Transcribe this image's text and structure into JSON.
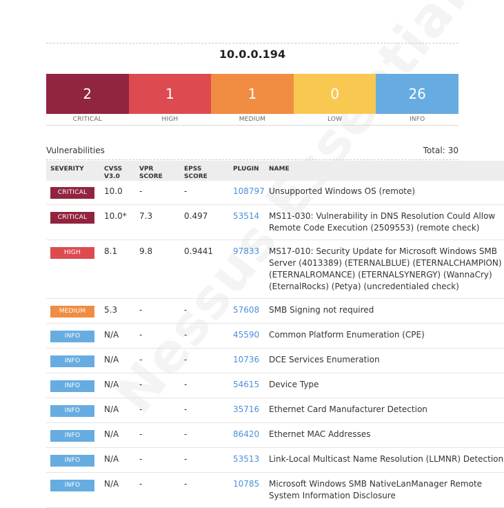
{
  "host": "10.0.0.194",
  "colors": {
    "critical": "#91243e",
    "high": "#dd4b50",
    "medium": "#f18c43",
    "low": "#f8c851",
    "info": "#67ace1"
  },
  "summary": [
    {
      "count": "2",
      "label": "CRITICAL",
      "severity": "critical"
    },
    {
      "count": "1",
      "label": "HIGH",
      "severity": "high"
    },
    {
      "count": "1",
      "label": "MEDIUM",
      "severity": "medium"
    },
    {
      "count": "0",
      "label": "LOW",
      "severity": "low"
    },
    {
      "count": "26",
      "label": "INFO",
      "severity": "info"
    }
  ],
  "vulnerabilities_title": "Vulnerabilities",
  "total_label": "Total:",
  "total_value": "30",
  "columns": {
    "severity": "SEVERITY",
    "cvss": "CVSS V3.0",
    "vpr": "VPR SCORE",
    "epss": "EPSS SCORE",
    "plugin": "PLUGIN",
    "name": "NAME"
  },
  "rows": [
    {
      "severity": "CRITICAL",
      "sev_key": "critical",
      "cvss": "10.0",
      "vpr": "-",
      "epss": "-",
      "plugin": "108797",
      "name": "Unsupported Windows OS (remote)"
    },
    {
      "severity": "CRITICAL",
      "sev_key": "critical",
      "cvss": "10.0*",
      "vpr": "7.3",
      "epss": "0.497",
      "plugin": "53514",
      "name": "MS11-030: Vulnerability in DNS Resolution Could Allow Remote Code Execution (2509553) (remote check)"
    },
    {
      "severity": "HIGH",
      "sev_key": "high",
      "cvss": "8.1",
      "vpr": "9.8",
      "epss": "0.9441",
      "plugin": "97833",
      "name": "MS17-010: Security Update for Microsoft Windows SMB Server (4013389) (ETERNALBLUE) (ETERNALCHAMPION) (ETERNALROMANCE) (ETERNALSYNERGY) (WannaCry) (EternalRocks) (Petya) (uncredentialed check)"
    },
    {
      "severity": "MEDIUM",
      "sev_key": "medium",
      "cvss": "5.3",
      "vpr": "-",
      "epss": "-",
      "plugin": "57608",
      "name": "SMB Signing not required"
    },
    {
      "severity": "INFO",
      "sev_key": "info",
      "cvss": "N/A",
      "vpr": "-",
      "epss": "-",
      "plugin": "45590",
      "name": "Common Platform Enumeration (CPE)"
    },
    {
      "severity": "INFO",
      "sev_key": "info",
      "cvss": "N/A",
      "vpr": "-",
      "epss": "-",
      "plugin": "10736",
      "name": "DCE Services Enumeration"
    },
    {
      "severity": "INFO",
      "sev_key": "info",
      "cvss": "N/A",
      "vpr": "-",
      "epss": "-",
      "plugin": "54615",
      "name": "Device Type"
    },
    {
      "severity": "INFO",
      "sev_key": "info",
      "cvss": "N/A",
      "vpr": "-",
      "epss": "-",
      "plugin": "35716",
      "name": "Ethernet Card Manufacturer Detection"
    },
    {
      "severity": "INFO",
      "sev_key": "info",
      "cvss": "N/A",
      "vpr": "-",
      "epss": "-",
      "plugin": "86420",
      "name": "Ethernet MAC Addresses"
    },
    {
      "severity": "INFO",
      "sev_key": "info",
      "cvss": "N/A",
      "vpr": "-",
      "epss": "-",
      "plugin": "53513",
      "name": "Link-Local Multicast Name Resolution (LLMNR) Detection"
    },
    {
      "severity": "INFO",
      "sev_key": "info",
      "cvss": "N/A",
      "vpr": "-",
      "epss": "-",
      "plugin": "10785",
      "name": "Microsoft Windows SMB NativeLanManager Remote System Information Disclosure"
    }
  ],
  "watermark_text": "Nessus Essentials"
}
